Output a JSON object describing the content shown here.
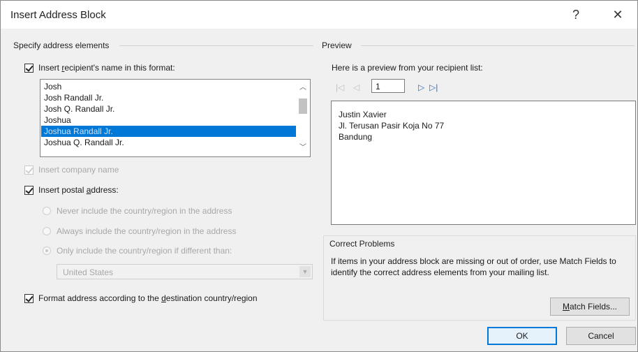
{
  "window": {
    "title": "Insert Address Block",
    "help": "?",
    "close": "✕"
  },
  "left": {
    "section_title": "Specify address elements",
    "name_format_checkbox": {
      "label_pre": "Insert ",
      "label_u": "r",
      "label_post": "ecipient's name in this format:",
      "checked": true
    },
    "name_formats": [
      "Josh",
      "Josh Randall Jr.",
      "Josh Q. Randall Jr.",
      "Joshua",
      "Joshua Randall Jr.",
      "Joshua Q. Randall Jr."
    ],
    "selected_index": 4,
    "company_checkbox": {
      "label": "Insert company name",
      "checked": true,
      "disabled": true
    },
    "postal_checkbox": {
      "label_pre": "Insert postal ",
      "label_u": "a",
      "label_post": "ddress:",
      "checked": true
    },
    "radios": [
      {
        "label": "Never include the country/region in the address",
        "selected": false
      },
      {
        "label": "Always include the country/region in the address",
        "selected": false
      },
      {
        "label": "Only include the country/region if different than:",
        "selected": true
      }
    ],
    "country_select": {
      "value": "United States"
    },
    "format_checkbox": {
      "label_pre": "Format address according to the ",
      "label_u": "d",
      "label_post": "estination country/region",
      "checked": true
    }
  },
  "right": {
    "section_title": "Preview",
    "preview_caption": "Here is a preview from your recipient list:",
    "nav": {
      "first_icon": "first-record-icon",
      "prev_icon": "previous-record-icon",
      "record": "1",
      "next_icon": "next-record-icon",
      "last_icon": "last-record-icon"
    },
    "preview_lines": [
      "Justin Xavier",
      "Jl. Terusan Pasir Koja No 77",
      "Bandung"
    ],
    "problems_title": "Correct Problems",
    "problems_text": "If items in your address block are missing or out of order, use Match Fields to identify the correct address elements from your mailing list.",
    "match_fields": {
      "label_u": "M",
      "label_post": "atch Fields..."
    }
  },
  "buttons": {
    "ok": "OK",
    "cancel": "Cancel"
  },
  "colors": {
    "selection": "#0078d7",
    "disabled_text": "#a8a8a8",
    "dialog_bg": "#f0f0f0"
  }
}
